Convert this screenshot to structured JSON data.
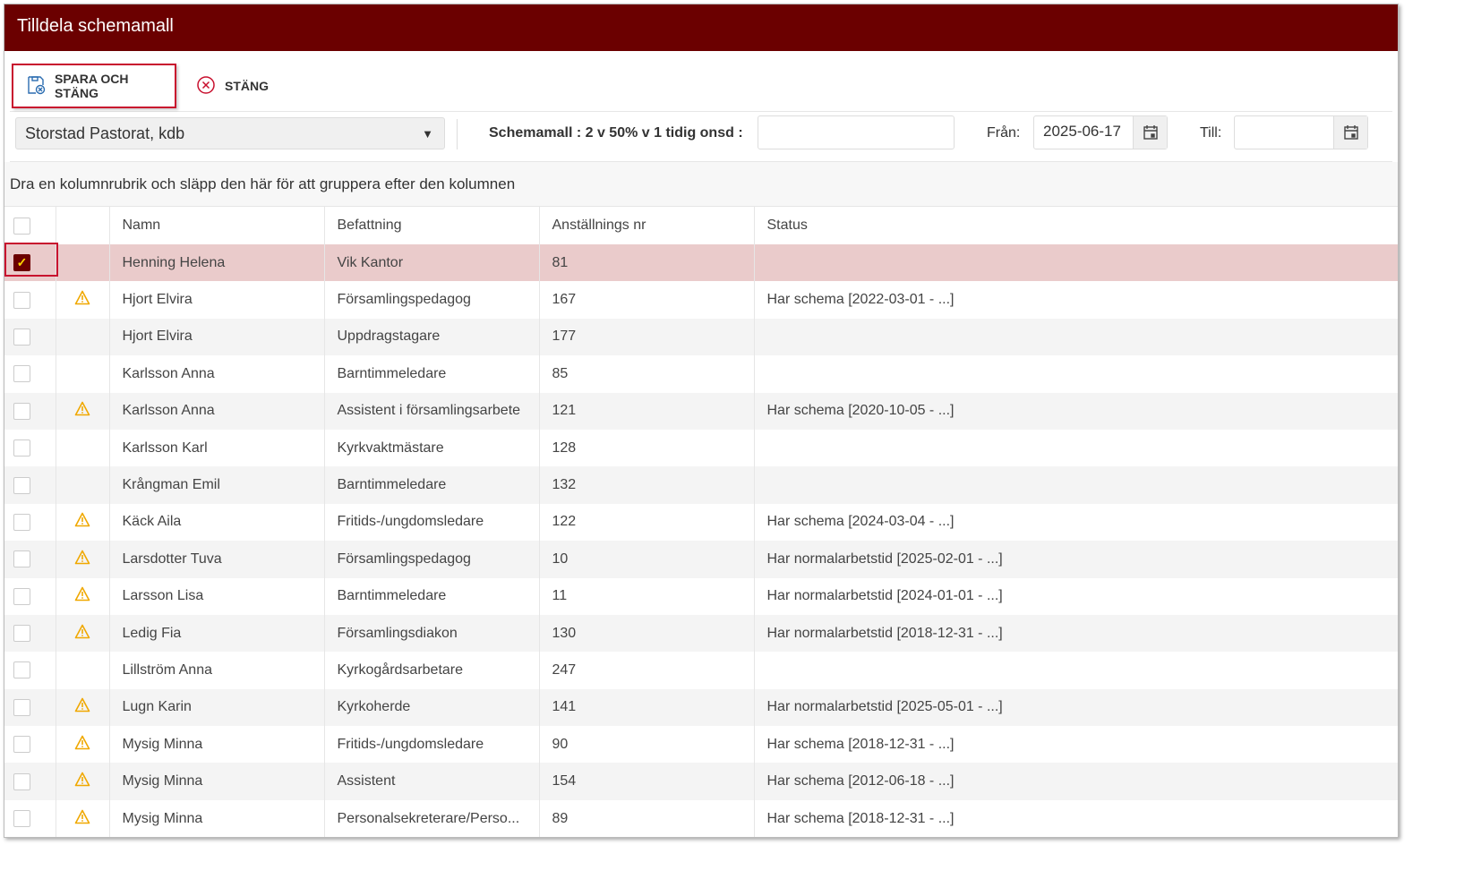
{
  "title": "Tilldela schemamall",
  "toolbar": {
    "save_label": "SPARA OCH STÄNG",
    "close_label": "STÄNG"
  },
  "filters": {
    "unit": "Storstad Pastorat, kdb",
    "template_label": "Schemamall : 2 v 50% v 1 tidig onsd :",
    "template_value": "",
    "from_label": "Från:",
    "from_value": "2025-06-17",
    "to_label": "Till:",
    "to_value": ""
  },
  "group_hint": "Dra en kolumnrubrik och släpp den här för att gruppera efter den kolumnen",
  "columns": [
    "Namn",
    "Befattning",
    "Anställnings nr",
    "Status"
  ],
  "rows": [
    {
      "checked": true,
      "warn": false,
      "name": "Henning Helena",
      "role": "Vik Kantor",
      "nr": "81",
      "status": ""
    },
    {
      "checked": false,
      "warn": true,
      "name": "Hjort Elvira",
      "role": "Församlingspedagog",
      "nr": "167",
      "status": "Har schema [2022-03-01 - ...]"
    },
    {
      "checked": false,
      "warn": false,
      "name": "Hjort Elvira",
      "role": "Uppdragstagare",
      "nr": "177",
      "status": ""
    },
    {
      "checked": false,
      "warn": false,
      "name": "Karlsson Anna",
      "role": "Barntimmeledare",
      "nr": "85",
      "status": ""
    },
    {
      "checked": false,
      "warn": true,
      "name": "Karlsson Anna",
      "role": "Assistent i församlingsarbete",
      "nr": "121",
      "status": "Har schema [2020-10-05 - ...]"
    },
    {
      "checked": false,
      "warn": false,
      "name": "Karlsson Karl",
      "role": "Kyrkvaktmästare",
      "nr": "128",
      "status": ""
    },
    {
      "checked": false,
      "warn": false,
      "name": "Krångman Emil",
      "role": "Barntimmeledare",
      "nr": "132",
      "status": ""
    },
    {
      "checked": false,
      "warn": true,
      "name": "Käck Aila",
      "role": "Fritids-/ungdomsledare",
      "nr": "122",
      "status": "Har schema [2024-03-04 - ...]"
    },
    {
      "checked": false,
      "warn": true,
      "name": "Larsdotter Tuva",
      "role": "Församlingspedagog",
      "nr": "10",
      "status": "Har normalarbetstid [2025-02-01 - ...]"
    },
    {
      "checked": false,
      "warn": true,
      "name": "Larsson Lisa",
      "role": "Barntimmeledare",
      "nr": "11",
      "status": "Har normalarbetstid [2024-01-01 - ...]"
    },
    {
      "checked": false,
      "warn": true,
      "name": "Ledig Fia",
      "role": "Församlingsdiakon",
      "nr": "130",
      "status": "Har normalarbetstid [2018-12-31 - ...]"
    },
    {
      "checked": false,
      "warn": false,
      "name": "Lillström Anna",
      "role": "Kyrkogårdsarbetare",
      "nr": "247",
      "status": ""
    },
    {
      "checked": false,
      "warn": true,
      "name": "Lugn Karin",
      "role": "Kyrkoherde",
      "nr": "141",
      "status": "Har normalarbetstid [2025-05-01 - ...]"
    },
    {
      "checked": false,
      "warn": true,
      "name": "Mysig Minna",
      "role": "Fritids-/ungdomsledare",
      "nr": "90",
      "status": "Har schema [2018-12-31 - ...]"
    },
    {
      "checked": false,
      "warn": true,
      "name": "Mysig Minna",
      "role": "Assistent",
      "nr": "154",
      "status": "Har schema [2012-06-18 - ...]"
    },
    {
      "checked": false,
      "warn": true,
      "name": "Mysig Minna",
      "role": "Personalsekreterare/Perso...",
      "nr": "89",
      "status": "Har schema [2018-12-31 - ...]"
    }
  ]
}
